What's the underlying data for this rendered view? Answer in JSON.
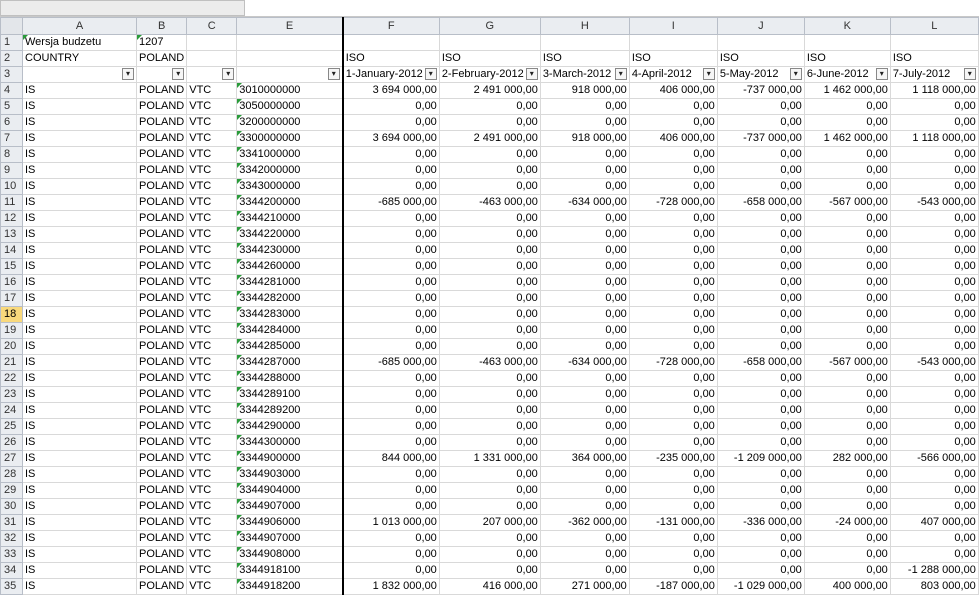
{
  "columns": [
    "A",
    "B",
    "C",
    "E",
    "F",
    "G",
    "H",
    "I",
    "J",
    "K",
    "L"
  ],
  "selected_row": 18,
  "header": {
    "r1": {
      "a": "Wersja budzetu",
      "b": "1207"
    },
    "r2": {
      "a": "COUNTRY",
      "b": "POLAND",
      "iso": "ISO"
    },
    "r3_dates": [
      "1-January-2012",
      "2-February-2012",
      "3-March-2012",
      "4-April-2012",
      "5-May-2012",
      "6-June-2012",
      "7-July-2012"
    ]
  },
  "filter_icon": "dropdown-arrow-icon",
  "filter_glyph": "▾",
  "rows": [
    {
      "n": "4",
      "a": "IS",
      "b": "POLAND",
      "c": "VTC",
      "e": "3010000000",
      "v": [
        "3 694 000,00",
        "2 491 000,00",
        "918 000,00",
        "406 000,00",
        "-737 000,00",
        "1 462 000,00",
        "1 118 000,00"
      ]
    },
    {
      "n": "5",
      "a": "IS",
      "b": "POLAND",
      "c": "VTC",
      "e": "3050000000",
      "v": [
        "0,00",
        "0,00",
        "0,00",
        "0,00",
        "0,00",
        "0,00",
        "0,00"
      ]
    },
    {
      "n": "6",
      "a": "IS",
      "b": "POLAND",
      "c": "VTC",
      "e": "3200000000",
      "v": [
        "0,00",
        "0,00",
        "0,00",
        "0,00",
        "0,00",
        "0,00",
        "0,00"
      ]
    },
    {
      "n": "7",
      "a": "IS",
      "b": "POLAND",
      "c": "VTC",
      "e": "3300000000",
      "v": [
        "3 694 000,00",
        "2 491 000,00",
        "918 000,00",
        "406 000,00",
        "-737 000,00",
        "1 462 000,00",
        "1 118 000,00"
      ]
    },
    {
      "n": "8",
      "a": "IS",
      "b": "POLAND",
      "c": "VTC",
      "e": "3341000000",
      "v": [
        "0,00",
        "0,00",
        "0,00",
        "0,00",
        "0,00",
        "0,00",
        "0,00"
      ]
    },
    {
      "n": "9",
      "a": "IS",
      "b": "POLAND",
      "c": "VTC",
      "e": "3342000000",
      "v": [
        "0,00",
        "0,00",
        "0,00",
        "0,00",
        "0,00",
        "0,00",
        "0,00"
      ]
    },
    {
      "n": "10",
      "a": "IS",
      "b": "POLAND",
      "c": "VTC",
      "e": "3343000000",
      "v": [
        "0,00",
        "0,00",
        "0,00",
        "0,00",
        "0,00",
        "0,00",
        "0,00"
      ]
    },
    {
      "n": "11",
      "a": "IS",
      "b": "POLAND",
      "c": "VTC",
      "e": "3344200000",
      "v": [
        "-685 000,00",
        "-463 000,00",
        "-634 000,00",
        "-728 000,00",
        "-658 000,00",
        "-567 000,00",
        "-543 000,00"
      ]
    },
    {
      "n": "12",
      "a": "IS",
      "b": "POLAND",
      "c": "VTC",
      "e": "3344210000",
      "v": [
        "0,00",
        "0,00",
        "0,00",
        "0,00",
        "0,00",
        "0,00",
        "0,00"
      ]
    },
    {
      "n": "13",
      "a": "IS",
      "b": "POLAND",
      "c": "VTC",
      "e": "3344220000",
      "v": [
        "0,00",
        "0,00",
        "0,00",
        "0,00",
        "0,00",
        "0,00",
        "0,00"
      ]
    },
    {
      "n": "14",
      "a": "IS",
      "b": "POLAND",
      "c": "VTC",
      "e": "3344230000",
      "v": [
        "0,00",
        "0,00",
        "0,00",
        "0,00",
        "0,00",
        "0,00",
        "0,00"
      ]
    },
    {
      "n": "15",
      "a": "IS",
      "b": "POLAND",
      "c": "VTC",
      "e": "3344260000",
      "v": [
        "0,00",
        "0,00",
        "0,00",
        "0,00",
        "0,00",
        "0,00",
        "0,00"
      ]
    },
    {
      "n": "16",
      "a": "IS",
      "b": "POLAND",
      "c": "VTC",
      "e": "3344281000",
      "v": [
        "0,00",
        "0,00",
        "0,00",
        "0,00",
        "0,00",
        "0,00",
        "0,00"
      ]
    },
    {
      "n": "17",
      "a": "IS",
      "b": "POLAND",
      "c": "VTC",
      "e": "3344282000",
      "v": [
        "0,00",
        "0,00",
        "0,00",
        "0,00",
        "0,00",
        "0,00",
        "0,00"
      ]
    },
    {
      "n": "18",
      "a": "IS",
      "b": "POLAND",
      "c": "VTC",
      "e": "3344283000",
      "v": [
        "0,00",
        "0,00",
        "0,00",
        "0,00",
        "0,00",
        "0,00",
        "0,00"
      ]
    },
    {
      "n": "19",
      "a": "IS",
      "b": "POLAND",
      "c": "VTC",
      "e": "3344284000",
      "v": [
        "0,00",
        "0,00",
        "0,00",
        "0,00",
        "0,00",
        "0,00",
        "0,00"
      ]
    },
    {
      "n": "20",
      "a": "IS",
      "b": "POLAND",
      "c": "VTC",
      "e": "3344285000",
      "v": [
        "0,00",
        "0,00",
        "0,00",
        "0,00",
        "0,00",
        "0,00",
        "0,00"
      ]
    },
    {
      "n": "21",
      "a": "IS",
      "b": "POLAND",
      "c": "VTC",
      "e": "3344287000",
      "v": [
        "-685 000,00",
        "-463 000,00",
        "-634 000,00",
        "-728 000,00",
        "-658 000,00",
        "-567 000,00",
        "-543 000,00"
      ]
    },
    {
      "n": "22",
      "a": "IS",
      "b": "POLAND",
      "c": "VTC",
      "e": "3344288000",
      "v": [
        "0,00",
        "0,00",
        "0,00",
        "0,00",
        "0,00",
        "0,00",
        "0,00"
      ]
    },
    {
      "n": "23",
      "a": "IS",
      "b": "POLAND",
      "c": "VTC",
      "e": "3344289100",
      "v": [
        "0,00",
        "0,00",
        "0,00",
        "0,00",
        "0,00",
        "0,00",
        "0,00"
      ]
    },
    {
      "n": "24",
      "a": "IS",
      "b": "POLAND",
      "c": "VTC",
      "e": "3344289200",
      "v": [
        "0,00",
        "0,00",
        "0,00",
        "0,00",
        "0,00",
        "0,00",
        "0,00"
      ]
    },
    {
      "n": "25",
      "a": "IS",
      "b": "POLAND",
      "c": "VTC",
      "e": "3344290000",
      "v": [
        "0,00",
        "0,00",
        "0,00",
        "0,00",
        "0,00",
        "0,00",
        "0,00"
      ]
    },
    {
      "n": "26",
      "a": "IS",
      "b": "POLAND",
      "c": "VTC",
      "e": "3344300000",
      "v": [
        "0,00",
        "0,00",
        "0,00",
        "0,00",
        "0,00",
        "0,00",
        "0,00"
      ]
    },
    {
      "n": "27",
      "a": "IS",
      "b": "POLAND",
      "c": "VTC",
      "e": "3344900000",
      "v": [
        "844 000,00",
        "1 331 000,00",
        "364 000,00",
        "-235 000,00",
        "-1 209 000,00",
        "282 000,00",
        "-566 000,00"
      ]
    },
    {
      "n": "28",
      "a": "IS",
      "b": "POLAND",
      "c": "VTC",
      "e": "3344903000",
      "v": [
        "0,00",
        "0,00",
        "0,00",
        "0,00",
        "0,00",
        "0,00",
        "0,00"
      ]
    },
    {
      "n": "29",
      "a": "IS",
      "b": "POLAND",
      "c": "VTC",
      "e": "3344904000",
      "v": [
        "0,00",
        "0,00",
        "0,00",
        "0,00",
        "0,00",
        "0,00",
        "0,00"
      ]
    },
    {
      "n": "30",
      "a": "IS",
      "b": "POLAND",
      "c": "VTC",
      "e": "3344907000",
      "v": [
        "0,00",
        "0,00",
        "0,00",
        "0,00",
        "0,00",
        "0,00",
        "0,00"
      ]
    },
    {
      "n": "31",
      "a": "IS",
      "b": "POLAND",
      "c": "VTC",
      "e": "3344906000",
      "v": [
        "1 013 000,00",
        "207 000,00",
        "-362 000,00",
        "-131 000,00",
        "-336 000,00",
        "-24 000,00",
        "407 000,00"
      ]
    },
    {
      "n": "32",
      "a": "IS",
      "b": "POLAND",
      "c": "VTC",
      "e": "3344907000",
      "v": [
        "0,00",
        "0,00",
        "0,00",
        "0,00",
        "0,00",
        "0,00",
        "0,00"
      ]
    },
    {
      "n": "33",
      "a": "IS",
      "b": "POLAND",
      "c": "VTC",
      "e": "3344908000",
      "v": [
        "0,00",
        "0,00",
        "0,00",
        "0,00",
        "0,00",
        "0,00",
        "0,00"
      ]
    },
    {
      "n": "34",
      "a": "IS",
      "b": "POLAND",
      "c": "VTC",
      "e": "3344918100",
      "v": [
        "0,00",
        "0,00",
        "0,00",
        "0,00",
        "0,00",
        "0,00",
        "-1 288 000,00"
      ]
    },
    {
      "n": "35",
      "a": "IS",
      "b": "POLAND",
      "c": "VTC",
      "e": "3344918200",
      "v": [
        "1 832 000,00",
        "416 000,00",
        "271 000,00",
        "-187 000,00",
        "-1 029 000,00",
        "400 000,00",
        "803 000,00"
      ]
    }
  ]
}
